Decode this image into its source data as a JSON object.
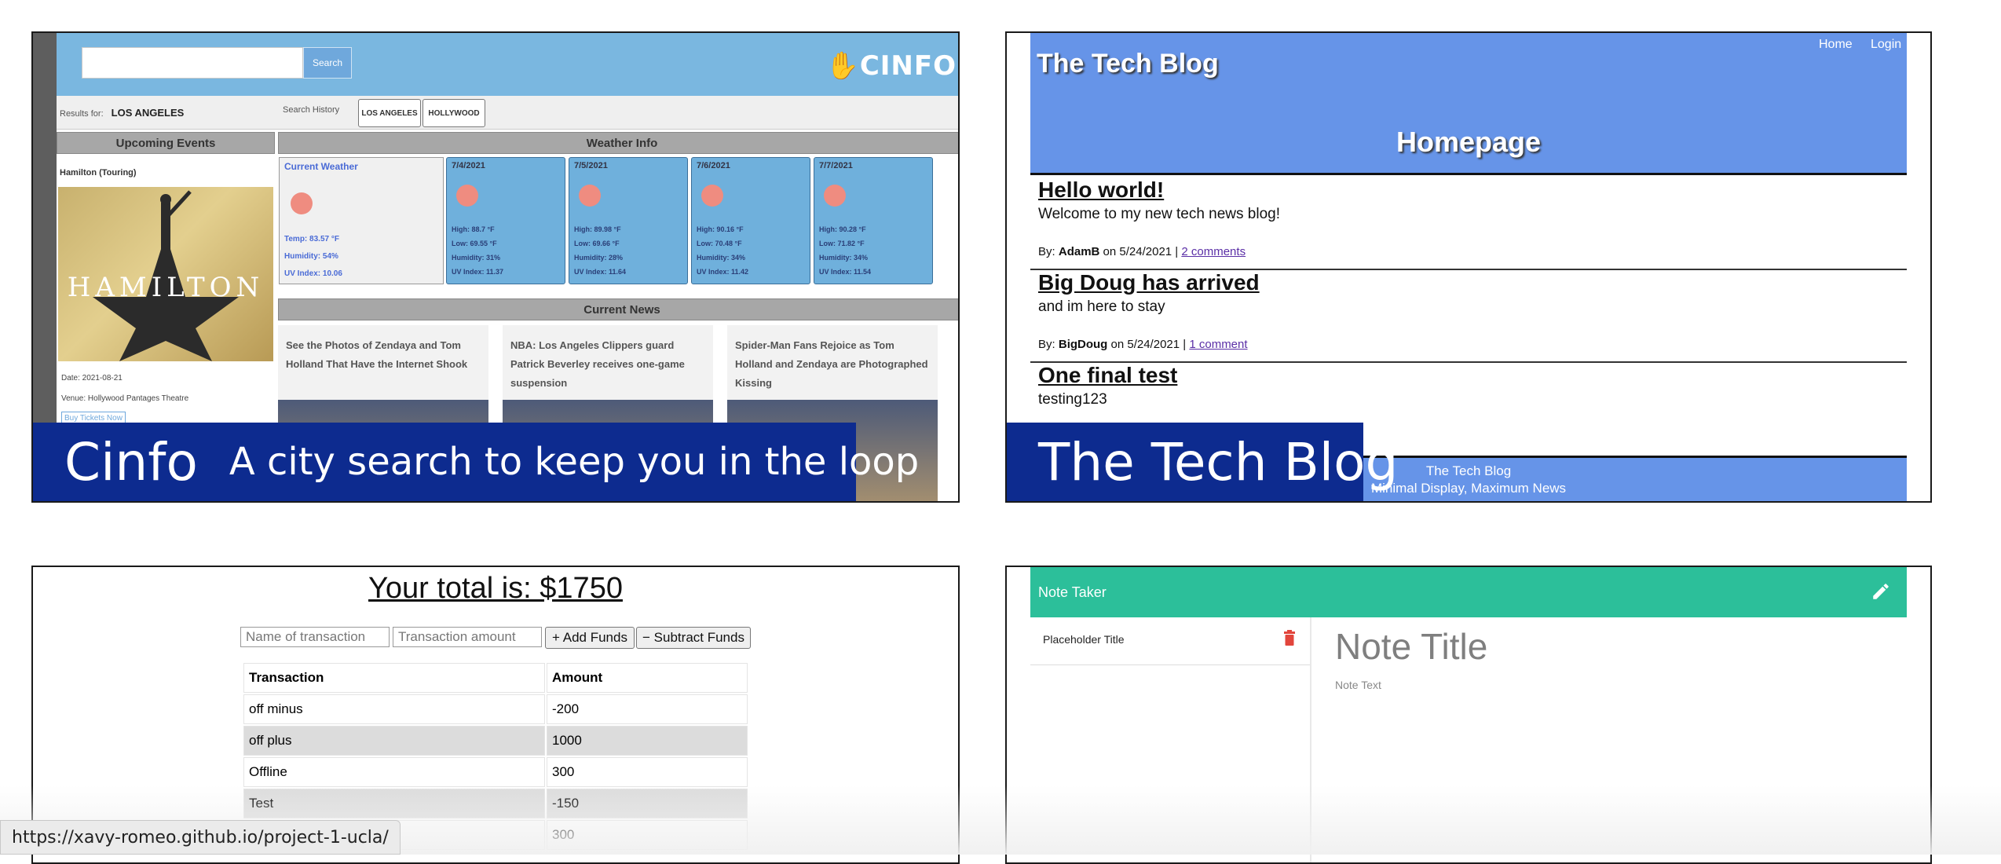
{
  "cinfo": {
    "search_button": "Search",
    "logo": "CINFO",
    "results_for_label": "Results for:",
    "results_for_value": "LOS ANGELES",
    "search_history_label": "Search History",
    "history": [
      "LOS ANGELES",
      "HOLLYWOOD"
    ],
    "upcoming_events_heading": "Upcoming Events",
    "weather_heading": "Weather Info",
    "news_heading": "Current News",
    "event": {
      "title": "Hamilton (Touring)",
      "poster_text": "HAMILTON",
      "date": "Date: 2021-08-21",
      "venue": "Venue: Hollywood Pantages Theatre",
      "buy": "Buy Tickets Now"
    },
    "current_weather": {
      "title": "Current Weather",
      "temp": "Temp: 83.57 °F",
      "humidity": "Humidity: 54%",
      "uv": "UV Index: 10.06"
    },
    "forecast": [
      {
        "date": "7/4/2021",
        "high": "High: 88.7 °F",
        "low": "Low: 69.55 °F",
        "humidity": "Humidity: 31%",
        "uv": "UV Index: 11.37"
      },
      {
        "date": "7/5/2021",
        "high": "High: 89.98 °F",
        "low": "Low: 69.66 °F",
        "humidity": "Humidity: 28%",
        "uv": "UV Index: 11.64"
      },
      {
        "date": "7/6/2021",
        "high": "High: 90.16 °F",
        "low": "Low: 70.48 °F",
        "humidity": "Humidity: 34%",
        "uv": "UV Index: 11.42"
      },
      {
        "date": "7/7/2021",
        "high": "High: 90.28 °F",
        "low": "Low: 71.82 °F",
        "humidity": "Humidity: 34%",
        "uv": "UV Index: 11.54"
      }
    ],
    "news": [
      "See the Photos of Zendaya and Tom Holland That Have the Internet Shook",
      "NBA: Los Angeles Clippers guard Patrick Beverley receives one-game suspension",
      "Spider-Man Fans Rejoice as Tom Holland and Zendaya are Photographed Kissing"
    ],
    "banner_title": "Cinfo",
    "banner_subtitle": "A city search to keep you in the loop"
  },
  "blog": {
    "title": "The Tech Blog",
    "nav": [
      "Home",
      "Login"
    ],
    "page_heading": "Homepage",
    "posts": [
      {
        "title": "Hello world!",
        "content": "Welcome to my new tech news blog!",
        "by": "By:",
        "author": "AdamB",
        "on": "on 5/24/2021 |",
        "comments": "2 comments"
      },
      {
        "title": "Big Doug has arrived",
        "content": "and im here to stay",
        "by": "By:",
        "author": "BigDoug",
        "on": "on 5/24/2021 |",
        "comments": "1 comment"
      },
      {
        "title": "One final test",
        "content": "testing123"
      }
    ],
    "footer_line1": "The Tech Blog",
    "footer_line2": "Minimal Display, Maximum News",
    "banner_title": "The Tech Blog"
  },
  "budget": {
    "total": "Your total is: $1750",
    "name_placeholder": "Name of transaction",
    "amount_placeholder": "Transaction amount",
    "add_button": "+ Add Funds",
    "subtract_button": "− Subtract Funds",
    "headers": [
      "Transaction",
      "Amount"
    ],
    "rows": [
      [
        "off minus",
        "-200"
      ],
      [
        "off plus",
        "1000"
      ],
      [
        "Offline",
        "300"
      ],
      [
        "Test",
        "-150"
      ],
      [
        "",
        "300"
      ]
    ]
  },
  "note": {
    "app_title": "Note Taker",
    "list_item": "Placeholder Title",
    "note_title_placeholder": "Note Title",
    "note_text_placeholder": "Note Text"
  },
  "status_url": "https://xavy-romeo.github.io/project-1-ucla/",
  "colors": {
    "banner": "#0d2b8f",
    "cinfo_header": "#7ab7e0",
    "blog_header": "#6694e8",
    "note_bar": "#2cbf9a"
  }
}
